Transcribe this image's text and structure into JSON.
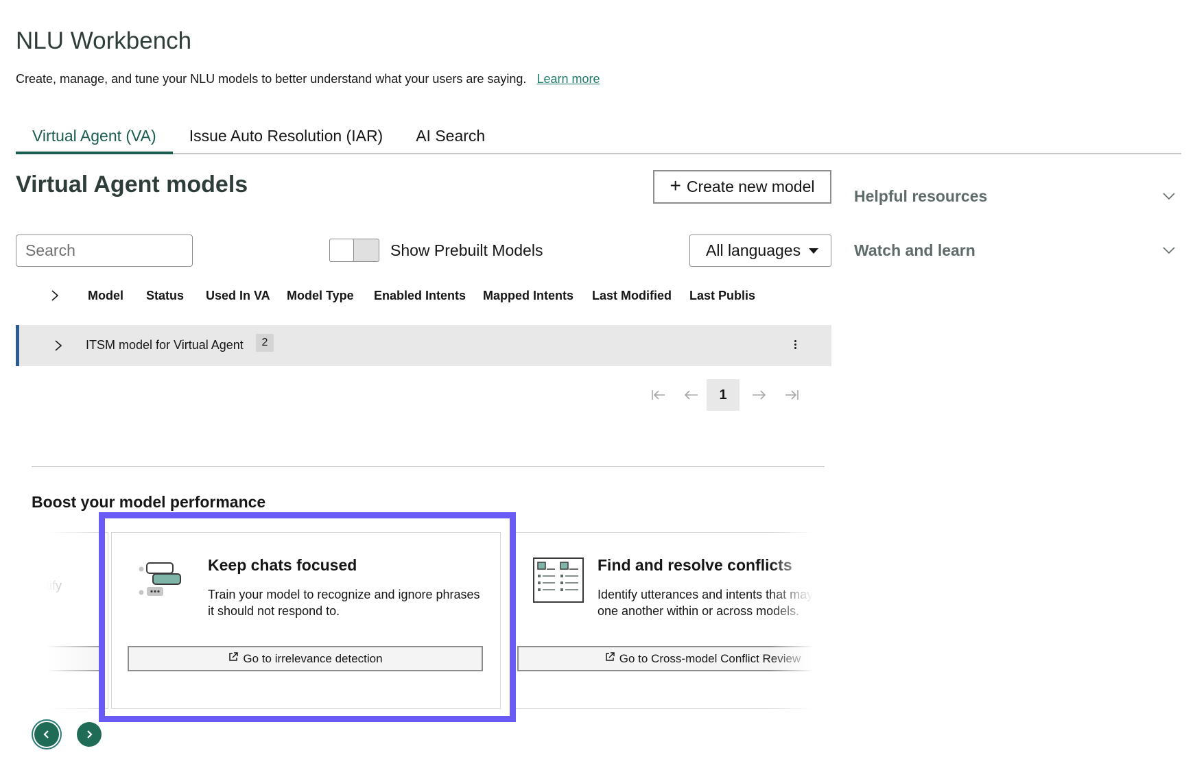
{
  "header": {
    "title": "NLU Workbench",
    "subtitle": "Create, manage, and tune your NLU models to better understand what your users are saying.",
    "learn_more": "Learn more"
  },
  "tabs": [
    {
      "label": "Virtual Agent (VA)",
      "active": true
    },
    {
      "label": "Issue Auto Resolution (IAR)",
      "active": false
    },
    {
      "label": "AI Search",
      "active": false
    }
  ],
  "models": {
    "title": "Virtual Agent models",
    "create_button": "Create new model",
    "search_placeholder": "Search",
    "toggle_label": "Show Prebuilt Models",
    "toggle_on": false,
    "language_select": "All languages",
    "columns": [
      "Model",
      "Status",
      "Used In VA",
      "Model Type",
      "Enabled Intents",
      "Mapped Intents",
      "Last Modified",
      "Last Publis"
    ],
    "rows": [
      {
        "name": "ITSM model for Virtual Agent",
        "count": "2"
      }
    ],
    "pagination": {
      "current_page": "1"
    }
  },
  "boost": {
    "title": "Boost your model performance",
    "partial_left_text": "entify",
    "cards": [
      {
        "title": "Keep chats focused",
        "description": "Train your model to recognize and ignore phrases it should not respond to.",
        "button": "Go to irrelevance detection",
        "icon": "chat-focus-icon"
      },
      {
        "title": "Find and resolve conflicts",
        "description": "Identify utterances and intents that may conflict with one another within or across models.",
        "button": "Go to Cross-model Conflict Review",
        "icon": "conflict-review-icon"
      }
    ]
  },
  "sidebar": {
    "items": [
      {
        "label": "Helpful resources"
      },
      {
        "label": "Watch and learn"
      }
    ]
  },
  "colors": {
    "accent": "#1a5c4f",
    "link": "#1f7a6b",
    "row_marker": "#2b5c93",
    "highlight": "#6b5bf5",
    "carousel_button": "#1f6b55"
  }
}
